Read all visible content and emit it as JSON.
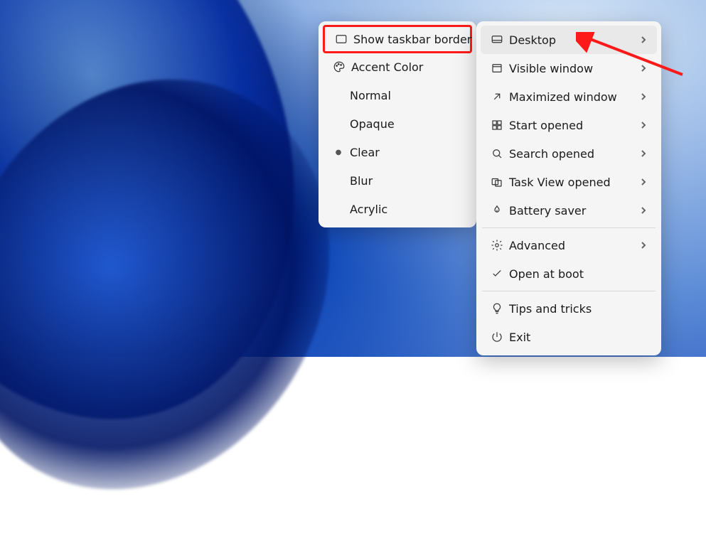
{
  "leftMenu": {
    "showTaskbarBorder": "Show taskbar border",
    "accentColor": "Accent Color",
    "options": {
      "normal": "Normal",
      "opaque": "Opaque",
      "clear": "Clear",
      "blur": "Blur",
      "acrylic": "Acrylic"
    },
    "selected": "clear"
  },
  "rightMenu": {
    "desktop": "Desktop",
    "visibleWindow": "Visible window",
    "maximizedWindow": "Maximized window",
    "startOpened": "Start opened",
    "searchOpened": "Search opened",
    "taskViewOpened": "Task View opened",
    "batterySaver": "Battery saver",
    "advanced": "Advanced",
    "openAtBoot": "Open at boot",
    "tipsTricks": "Tips and tricks",
    "exit": "Exit"
  },
  "annotations": {
    "highlightedLeftItem": "showTaskbarBorder",
    "arrowTarget": "desktop"
  },
  "colors": {
    "annotationRed": "#ff1a1a",
    "menuBg": "#f5f5f5",
    "hoverBg": "#e9e9e9"
  }
}
